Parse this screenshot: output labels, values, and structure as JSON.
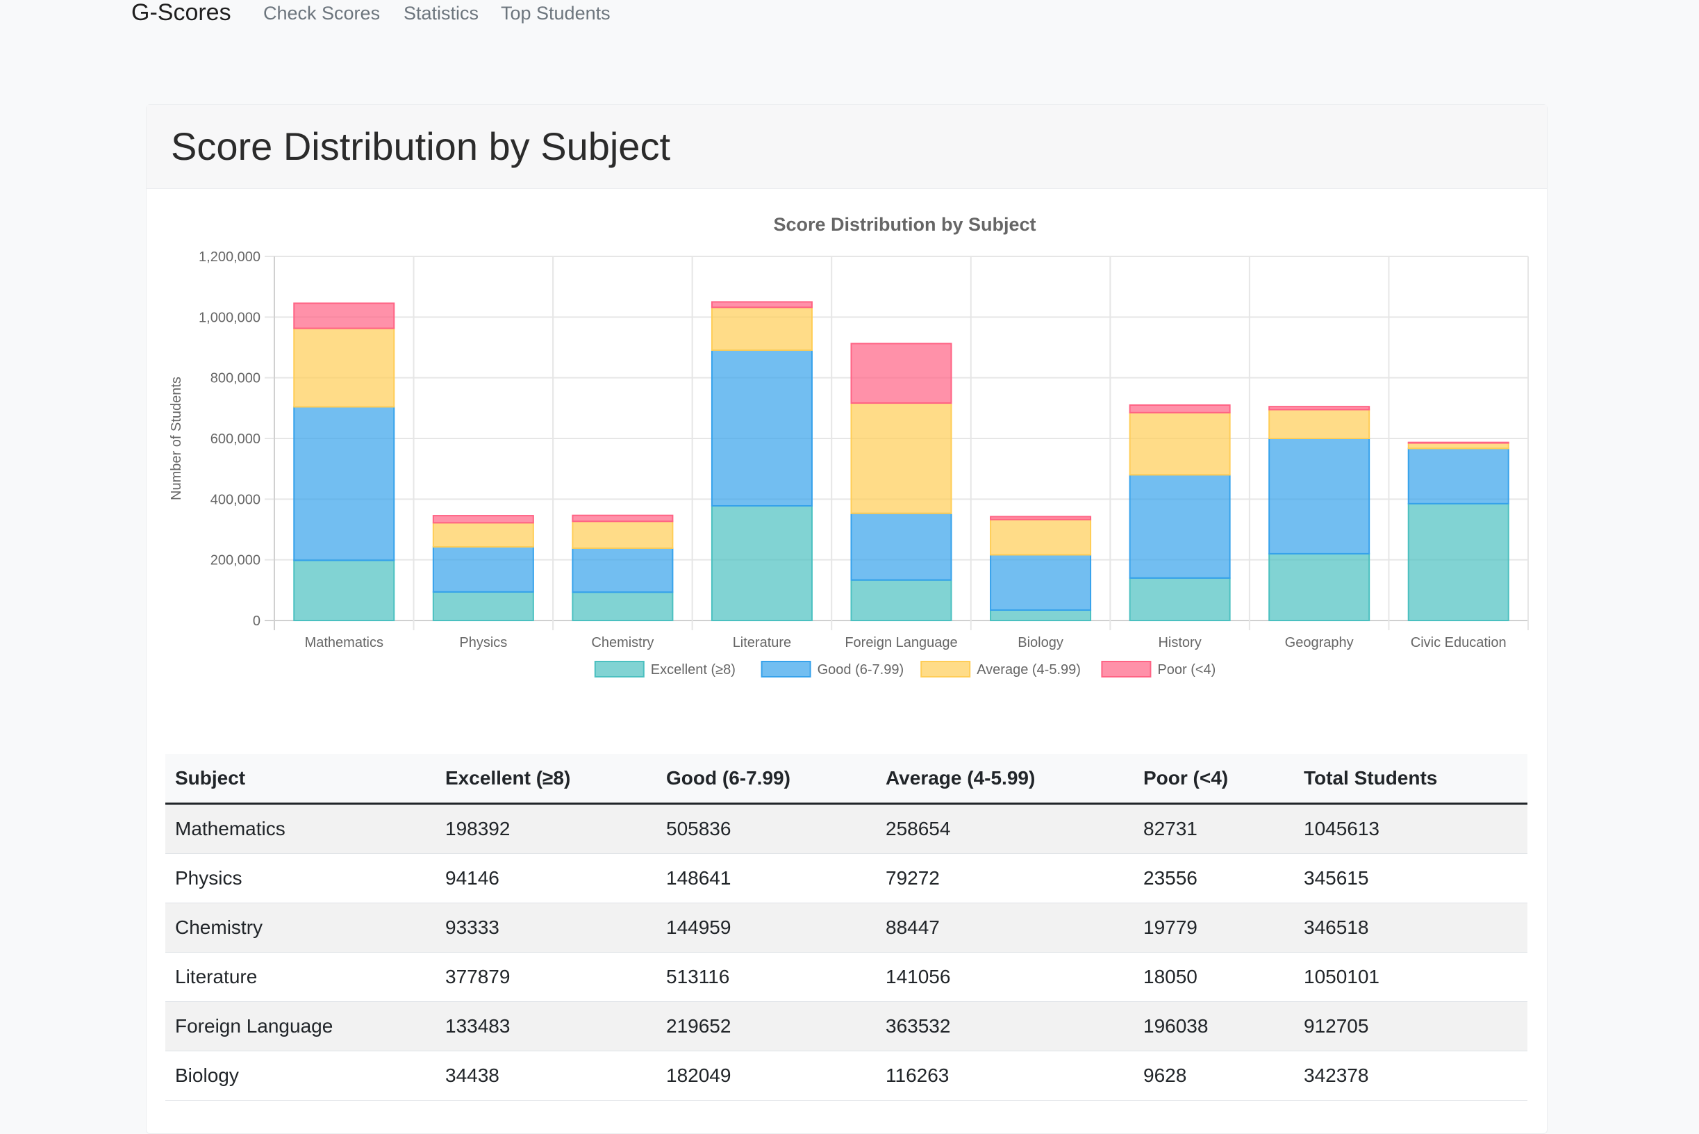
{
  "nav": {
    "brand": "G-Scores",
    "links": [
      "Check Scores",
      "Statistics",
      "Top Students"
    ]
  },
  "page": {
    "title": "Score Distribution by Subject"
  },
  "colors": {
    "excellent": "#4bc0c0",
    "good": "#36a2eb",
    "average": "#ffcd56",
    "poor": "#ff6384"
  },
  "chart_data": {
    "type": "bar",
    "stacked": true,
    "title": "Score Distribution by Subject",
    "xlabel": "",
    "ylabel": "Number of Students",
    "ylim": [
      0,
      1200000
    ],
    "yticks": [
      "0",
      "200,000",
      "400,000",
      "600,000",
      "800,000",
      "1,000,000",
      "1,200,000"
    ],
    "grid": true,
    "legend_position": "bottom",
    "categories": [
      "Mathematics",
      "Physics",
      "Chemistry",
      "Literature",
      "Foreign Language",
      "Biology",
      "History",
      "Geography",
      "Civic Education"
    ],
    "series": [
      {
        "name": "Excellent (≥8)",
        "color": "#4bc0c0",
        "values": [
          198392,
          94146,
          93333,
          377879,
          133483,
          34438,
          140000,
          220000,
          385000
        ]
      },
      {
        "name": "Good (6-7.99)",
        "color": "#36a2eb",
        "values": [
          505836,
          148641,
          144959,
          513116,
          219652,
          182049,
          340000,
          380000,
          182000
        ]
      },
      {
        "name": "Average (4-5.99)",
        "color": "#ffcd56",
        "values": [
          258654,
          79272,
          88447,
          141056,
          363532,
          116263,
          205000,
          95000,
          18000
        ]
      },
      {
        "name": "Poor (<4)",
        "color": "#ff6384",
        "values": [
          82731,
          23556,
          19779,
          18050,
          196038,
          9628,
          25000,
          10000,
          2000
        ]
      }
    ]
  },
  "table": {
    "headers": [
      "Subject",
      "Excellent (≥8)",
      "Good (6-7.99)",
      "Average (4-5.99)",
      "Poor (<4)",
      "Total Students"
    ],
    "rows": [
      [
        "Mathematics",
        "198392",
        "505836",
        "258654",
        "82731",
        "1045613"
      ],
      [
        "Physics",
        "94146",
        "148641",
        "79272",
        "23556",
        "345615"
      ],
      [
        "Chemistry",
        "93333",
        "144959",
        "88447",
        "19779",
        "346518"
      ],
      [
        "Literature",
        "377879",
        "513116",
        "141056",
        "18050",
        "1050101"
      ],
      [
        "Foreign Language",
        "133483",
        "219652",
        "363532",
        "196038",
        "912705"
      ],
      [
        "Biology",
        "34438",
        "182049",
        "116263",
        "9628",
        "342378"
      ]
    ]
  }
}
